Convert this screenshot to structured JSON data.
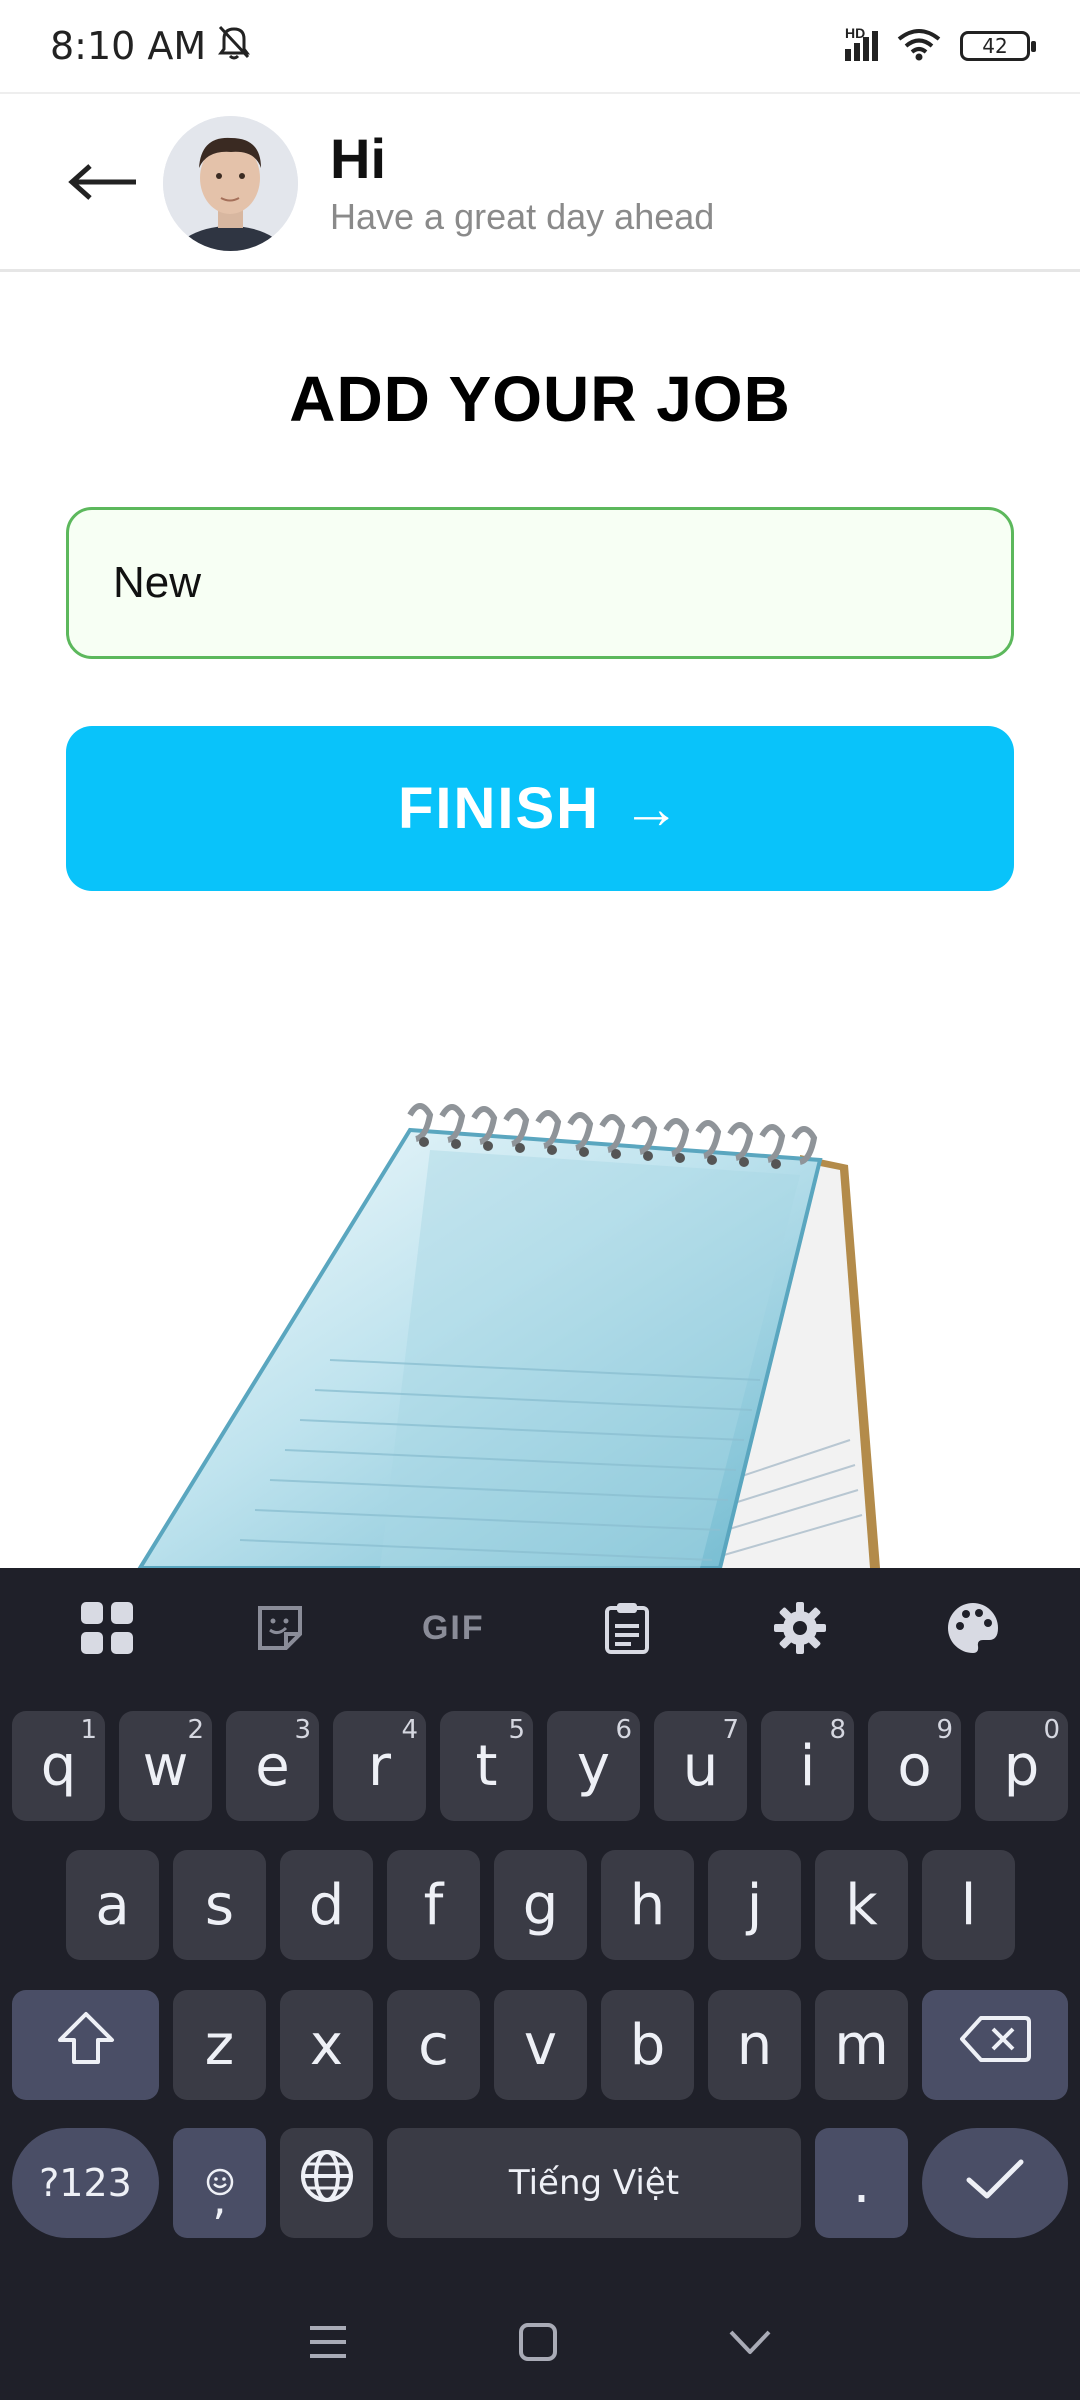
{
  "status_bar": {
    "time": "8:10 AM",
    "network_badge": "HD",
    "battery_level": "42"
  },
  "header": {
    "title": "Hi",
    "subtitle": "Have a great day ahead"
  },
  "main": {
    "title": "ADD YOUR JOB",
    "job_input_value": "New",
    "finish_label": "FINISH",
    "finish_arrow": "→"
  },
  "keyboard": {
    "toolbar": [
      "apps-grid-icon",
      "sticker-icon",
      "gif-icon",
      "clipboard-icon",
      "gear-icon",
      "palette-icon"
    ],
    "gif_label": "GIF",
    "row1": [
      {
        "k": "q",
        "n": "1"
      },
      {
        "k": "w",
        "n": "2"
      },
      {
        "k": "e",
        "n": "3"
      },
      {
        "k": "r",
        "n": "4"
      },
      {
        "k": "t",
        "n": "5"
      },
      {
        "k": "y",
        "n": "6"
      },
      {
        "k": "u",
        "n": "7"
      },
      {
        "k": "i",
        "n": "8"
      },
      {
        "k": "o",
        "n": "9"
      },
      {
        "k": "p",
        "n": "0"
      }
    ],
    "row2": [
      "a",
      "s",
      "d",
      "f",
      "g",
      "h",
      "j",
      "k",
      "l"
    ],
    "row3": [
      "z",
      "x",
      "c",
      "v",
      "b",
      "n",
      "m"
    ],
    "symbols_label": "?123",
    "comma_label": ",",
    "space_label": "Tiếng Việt",
    "period_label": "."
  },
  "colors": {
    "accent": "#09c3fa",
    "input_border": "#5cb85c",
    "keyboard_bg": "#1f2029"
  }
}
